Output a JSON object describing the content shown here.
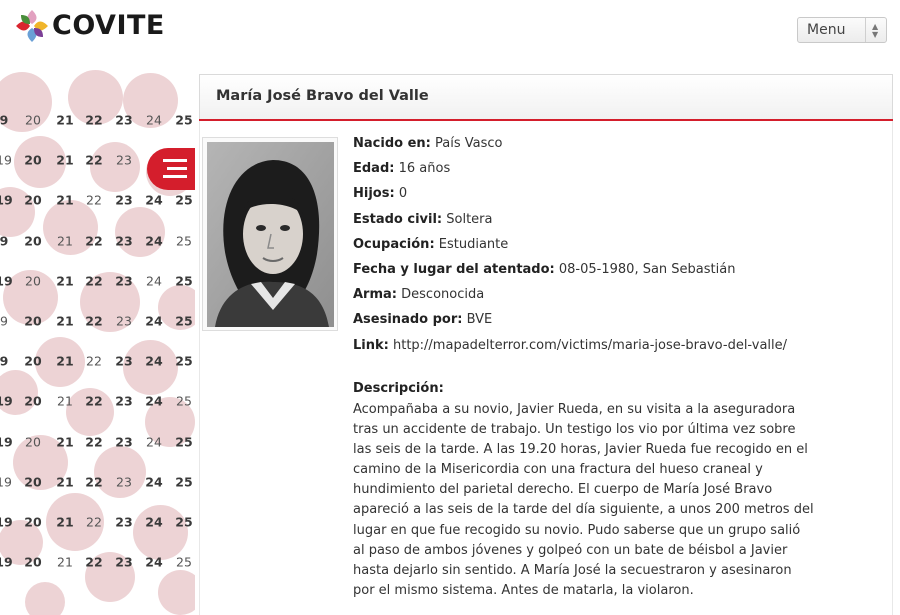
{
  "header": {
    "brand": "COVITE",
    "menu_label": "Menu"
  },
  "map": {
    "rows": [
      [
        "9",
        "20",
        "21",
        "22",
        "23",
        "24",
        "25"
      ],
      [
        "19",
        "20",
        "21",
        "22",
        "23",
        "",
        ""
      ],
      [
        "19",
        "20",
        "21",
        "22",
        "23",
        "24",
        "25"
      ],
      [
        "9",
        "20",
        "21",
        "22",
        "23",
        "24",
        "25"
      ],
      [
        "19",
        "20",
        "21",
        "22",
        "23",
        "24",
        "25"
      ],
      [
        "9",
        "20",
        "21",
        "22",
        "23",
        "24",
        "25"
      ],
      [
        "9",
        "20",
        "21",
        "22",
        "23",
        "24",
        "25"
      ],
      [
        "19",
        "20",
        "21",
        "22",
        "23",
        "24",
        "25"
      ],
      [
        "19",
        "20",
        "21",
        "22",
        "23",
        "24",
        "25"
      ],
      [
        "19",
        "20",
        "21",
        "22",
        "23",
        "24",
        "25"
      ],
      [
        "19",
        "20",
        "21",
        "22",
        "23",
        "24",
        "25"
      ],
      [
        "19",
        "20",
        "21",
        "22",
        "23",
        "24",
        "25"
      ]
    ]
  },
  "victim": {
    "name": "María José Bravo del Valle",
    "fields": [
      {
        "label": "Nacido en:",
        "value": "País Vasco"
      },
      {
        "label": "Edad:",
        "value": "16 años"
      },
      {
        "label": "Hijos:",
        "value": "0"
      },
      {
        "label": "Estado civil:",
        "value": "Soltera"
      },
      {
        "label": "Ocupación:",
        "value": "Estudiante"
      },
      {
        "label": "Fecha y lugar del atentado:",
        "value": "08-05-1980, San Sebastián"
      },
      {
        "label": "Arma:",
        "value": "Desconocida"
      },
      {
        "label": "Asesinado por:",
        "value": "BVE"
      },
      {
        "label": "Link:",
        "value": "http://mapadelterror.com/victims/maria-jose-bravo-del-valle/"
      }
    ],
    "description_title": "Descripción:",
    "description": "Acompañaba a su novio, Javier Rueda, en su visita a la aseguradora tras un accidente de trabajo. Un testigo los vio por última vez sobre las seis de la tarde. A las 19.20 horas, Javier Rueda fue recogido en el camino de la Misericordia con una fractura del hueso craneal y hundimiento del parietal derecho. El cuerpo de María José Bravo apareció a las seis de la tarde del día siguiente, a unos 200 metros del lugar en que fue recogido su novio. Pudo saberse que un grupo salió al paso de ambos jóvenes y golpeó con un bate de béisbol a Javier hasta dejarlo sin sentido. A María José la secuestraron y asesinaron por el mismo sistema. Antes de matarla, la violaron."
  },
  "colors": {
    "accent": "#d41e2c",
    "map_circle": "#c97880"
  }
}
